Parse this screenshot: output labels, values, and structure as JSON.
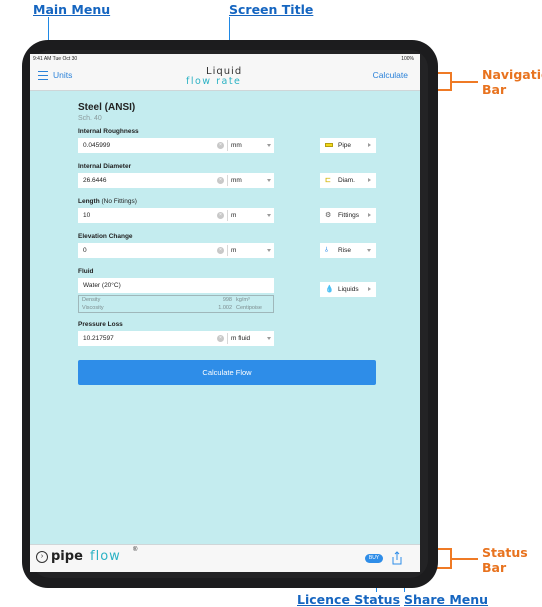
{
  "annotations": {
    "main_menu": "Main Menu",
    "screen_title": "Screen Title",
    "navigation_bar": [
      "Navigation",
      "Bar"
    ],
    "status_bar": [
      "Status",
      "Bar"
    ],
    "licence_status": "Licence Status",
    "share_menu": "Share Menu"
  },
  "ios_status": {
    "time": "9:41 AM  Tue Oct 30",
    "battery": "100%"
  },
  "navbar": {
    "units_label": "Units",
    "logo_top": "Liquid",
    "logo_bottom": "flow rate",
    "calculate_label": "Calculate"
  },
  "material": {
    "name": "Steel (ANSI)",
    "schedule": "Sch. 40"
  },
  "fields": {
    "roughness": {
      "label": "Internal Roughness",
      "value": "0.045999",
      "unit": "mm"
    },
    "diameter": {
      "label": "Internal Diameter",
      "value": "26.6446",
      "unit": "mm"
    },
    "length": {
      "label": "Length",
      "label_note": "(No Fittings)",
      "value": "10",
      "unit": "m"
    },
    "elevation": {
      "label": "Elevation Change",
      "value": "0",
      "unit": "m"
    },
    "fluid": {
      "label": "Fluid",
      "value": "Water (20°C)"
    },
    "pressure": {
      "label": "Pressure Loss",
      "value": "10.217597",
      "unit": "m fluid"
    }
  },
  "fluid_props": {
    "density_label": "Density",
    "density_value": "998",
    "density_unit": "kg/m³",
    "viscosity_label": "Viscosity",
    "viscosity_value": "1.002",
    "viscosity_unit": "Centipoise"
  },
  "side_buttons": {
    "pipe": "Pipe",
    "diam": "Diam.",
    "fittings": "Fittings",
    "rise": "Rise",
    "liquids": "Liquids"
  },
  "calculate_flow_label": "Calculate Flow",
  "bottom": {
    "brand_pipe": "pipe",
    "brand_flow": "flow",
    "brand_reg": "®",
    "buy_label": "BUY"
  },
  "colors": {
    "accent": "#2e8de8",
    "screen_background": "#c4ecef",
    "annotation_blue": "#1565c0",
    "annotation_orange": "#e8731f"
  }
}
